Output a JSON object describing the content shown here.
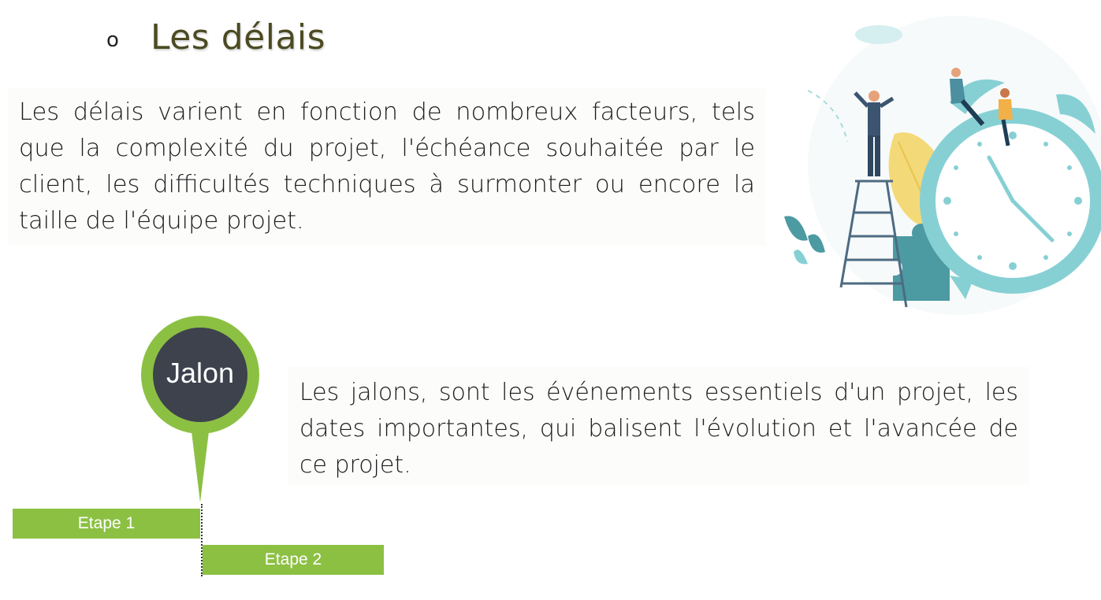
{
  "heading": {
    "bullet": "o",
    "title": "Les délais"
  },
  "paragraphs": {
    "delais": "Les délais varient en fonction de nombreux facteurs, tels que la complexité du projet, l'échéance souhaitée par le client, les difficultés techniques à surmonter ou encore la taille de l'équipe projet.",
    "jalons": "Les jalons, sont les événements essentiels d'un projet, les dates importantes, qui balisent l'évolution et l'avancée de ce projet."
  },
  "milestone": {
    "label": "Jalon",
    "steps": [
      "Etape 1",
      "Etape 2"
    ]
  },
  "colors": {
    "title": "#4b4a22",
    "green": "#8cc043",
    "badge_dark": "#3d424d",
    "clock_teal": "#86d0d4"
  },
  "icons": [
    "clock-illustration",
    "ladder-icon",
    "puzzle-icon",
    "leaf-icon",
    "person-icon",
    "milestone-pin-icon"
  ]
}
